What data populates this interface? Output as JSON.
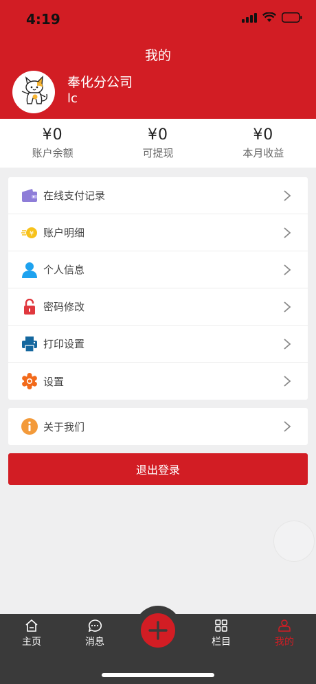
{
  "status_bar": {
    "time": "4:19"
  },
  "header": {
    "title": "我的",
    "company": "奉化分公司",
    "username": "lc"
  },
  "stats": [
    {
      "value": "¥0",
      "label": "账户余额"
    },
    {
      "value": "¥0",
      "label": "可提现"
    },
    {
      "value": "¥0",
      "label": "本月收益"
    }
  ],
  "menu": {
    "items": [
      {
        "label": "在线支付记录",
        "icon": "wallet-icon"
      },
      {
        "label": "账户明细",
        "icon": "coin-icon"
      },
      {
        "label": "个人信息",
        "icon": "person-icon"
      },
      {
        "label": "密码修改",
        "icon": "lock-icon"
      },
      {
        "label": "打印设置",
        "icon": "printer-icon"
      },
      {
        "label": "设置",
        "icon": "settings-icon"
      }
    ],
    "about": {
      "label": "关于我们",
      "icon": "info-icon"
    }
  },
  "logout_label": "退出登录",
  "tabbar": {
    "home": "主页",
    "messages": "消息",
    "columns": "栏目",
    "mine": "我的"
  },
  "colors": {
    "brand": "#d21d24",
    "tabbar": "#3a3a3a"
  }
}
